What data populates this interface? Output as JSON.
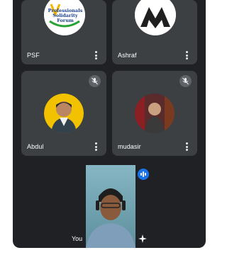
{
  "participants": [
    {
      "name": "PSF",
      "muted": false,
      "logo_text": [
        "Professionals",
        "Solidarity",
        "Forum"
      ]
    },
    {
      "name": "Ashraf",
      "muted": false
    },
    {
      "name": "Abdul",
      "muted": true
    },
    {
      "name": "mudasir",
      "muted": true
    }
  ],
  "self_view": {
    "name": "You",
    "speaking": true
  },
  "colors": {
    "stage": "#202124",
    "tile": "#3c4043",
    "speaking_indicator": "#1a73e8"
  },
  "icons": [
    "more-options-icon",
    "mic-off-icon",
    "audio-level-icon",
    "sparkle-effects-icon"
  ]
}
